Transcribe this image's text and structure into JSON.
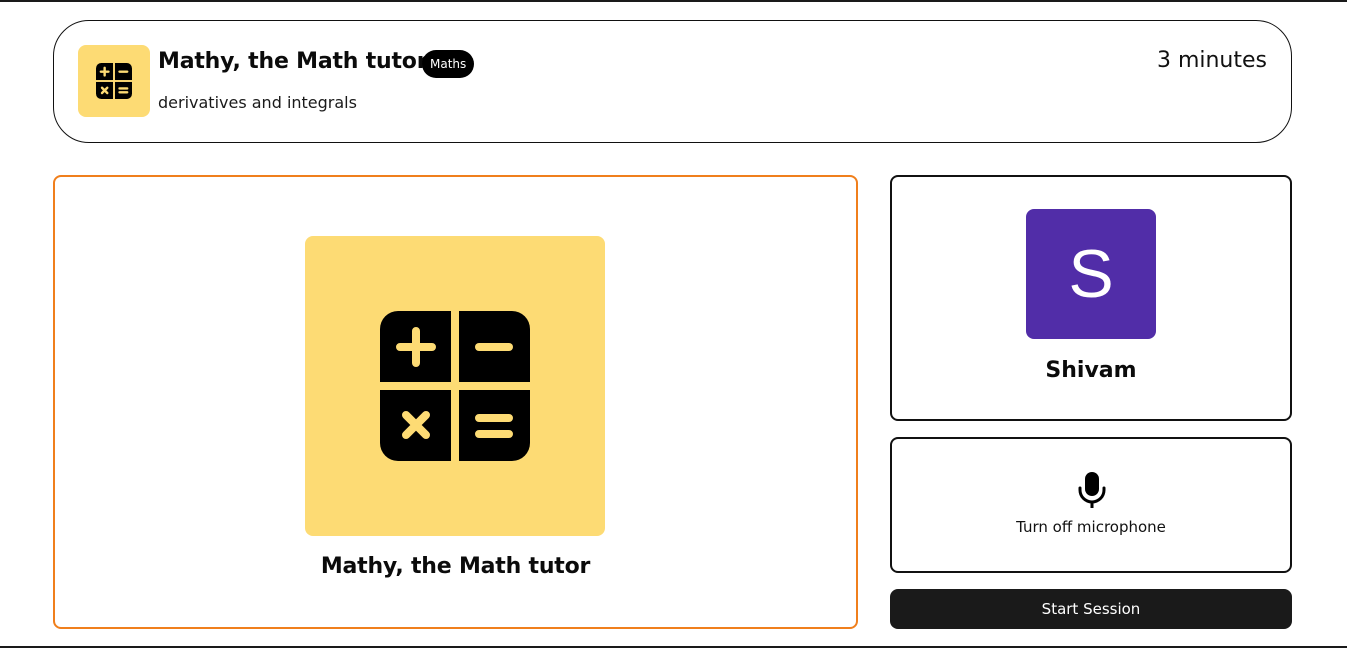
{
  "header": {
    "title": "Mathy, the Math tutor",
    "subject_badge": "Maths",
    "topic": "derivatives and integrals",
    "duration": "3 minutes",
    "icon": "calculator-icon",
    "tile_color": "#fddb74"
  },
  "companion": {
    "name": "Mathy, the Math tutor",
    "icon": "calculator-icon",
    "tile_color": "#fddb74",
    "border_color": "#f07f1c"
  },
  "user": {
    "avatar_letter": "S",
    "name": "Shivam",
    "avatar_color": "#512da8"
  },
  "mic": {
    "icon": "microphone-icon",
    "label": "Turn off microphone"
  },
  "actions": {
    "start_label": "Start Session"
  }
}
